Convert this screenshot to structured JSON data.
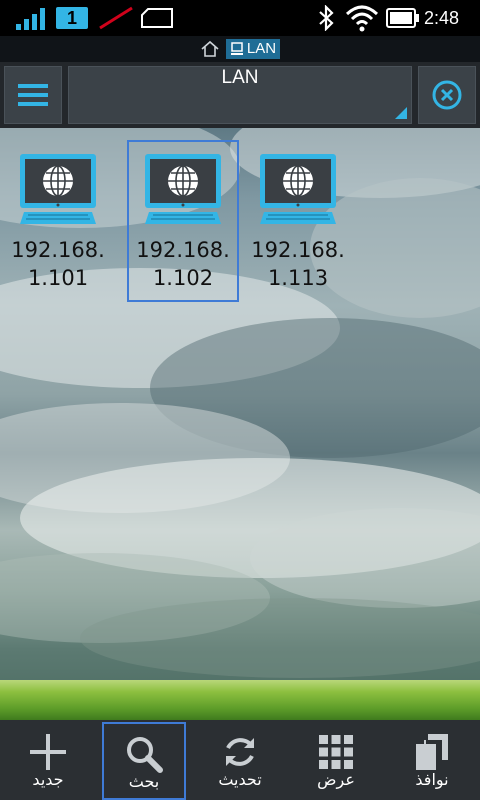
{
  "status_bar": {
    "sim_number": "1",
    "time": "2:48",
    "icons": [
      "signal-icon",
      "sim-icon",
      "no-data-icon",
      "message-icon",
      "bluetooth-icon",
      "wifi-icon",
      "battery-icon"
    ]
  },
  "path_bar": {
    "home_icon": "home-icon",
    "current": "LAN"
  },
  "toolbar": {
    "location": "LAN",
    "menu_icon": "hamburger-icon",
    "close_icon": "close-circle-icon"
  },
  "files": [
    {
      "label_line1": "192.168.",
      "label_line2": "1.101",
      "selected": false
    },
    {
      "label_line1": "192.168.",
      "label_line2": "1.102",
      "selected": true
    },
    {
      "label_line1": "192.168.",
      "label_line2": "1.113",
      "selected": false
    }
  ],
  "bottom_bar": {
    "items": [
      {
        "label": "جديد",
        "icon": "plus-icon"
      },
      {
        "label": "بحث",
        "icon": "search-icon",
        "active": true
      },
      {
        "label": "تحديث",
        "icon": "refresh-icon"
      },
      {
        "label": "عرض",
        "icon": "grid-icon"
      },
      {
        "label": "نوافذ",
        "icon": "windows-icon"
      }
    ]
  },
  "colors": {
    "accent": "#33b5e5",
    "selection": "#3f7bd6",
    "toolbar_bg": "#23272b",
    "bottom_bg": "#2b2f33"
  }
}
